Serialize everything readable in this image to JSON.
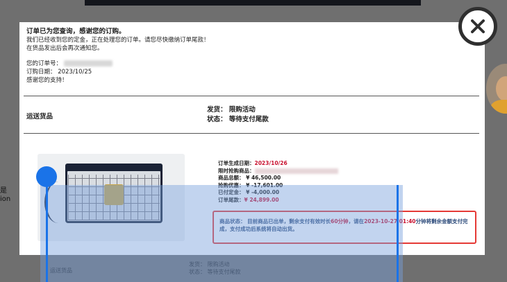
{
  "background": {
    "left_text": [
      "是",
      "ion"
    ]
  },
  "message": {
    "title": "订单已为您查询，感谢您的订购。",
    "line1": "我们已经收到您的定金，正在处理您的订单。请您尽快缴纳订单尾款！",
    "line2": "在货品发出后会再次通知您。",
    "order_no_label": "您的订单号：",
    "order_date": "订购日期： 2023/10/25",
    "thanks": "感谢您的支持！"
  },
  "shipping": {
    "label": "运送货品",
    "ship_line": "发货： 限购活动",
    "status_line": "状态： 等待支付尾款"
  },
  "details": {
    "created_label": "订单生成日期：",
    "created_value": "2023/10/26",
    "product_label": "限时抢购商品：",
    "total": "商品总额： ¥ 46,500.00",
    "discount": "抢购优惠： ¥ -17,601.00",
    "deposit": "已付定金： ¥ -4,000.00",
    "balance_label": "订单尾款：",
    "balance_value": "¥ 24,899.00"
  },
  "status_box": {
    "part1": "商品状态： 目前商品已出单，剩余支付有效时长",
    "duration": "60分钟",
    "part2": "，请在",
    "deadline": "2023-10-27 01:40",
    "part3": "分钟将剩余金额支付完成，支付成功后系统将自动出货。"
  },
  "under": {
    "ship_label": "运送货品",
    "ship_line": "发货： 限购活动",
    "status_line": "状态： 等待支付尾款"
  },
  "icons": {
    "close": "close-icon"
  },
  "colors": {
    "highlight": "#e53935",
    "selection": "#1a73e8",
    "price_red": "#c8102e"
  }
}
